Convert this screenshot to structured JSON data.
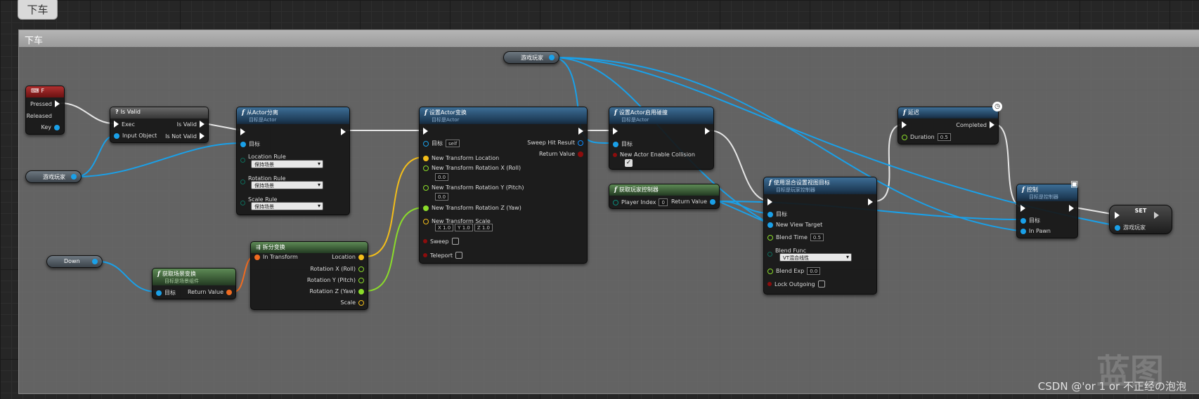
{
  "comment": {
    "tab_label": "下车",
    "header_label": "下车"
  },
  "colors": {
    "exec": "#ffffff",
    "object": "#1aa0e8",
    "bool": "#8c0d0d",
    "float": "#8bdc2a",
    "vector": "#f3be1a",
    "rotator": "#9bb0ff",
    "transform": "#f06b20",
    "byte": "#0e6b5a",
    "struct": "#0a8a7a"
  },
  "nodes": {
    "input_f": {
      "title": "F",
      "icon": "keyboard-icon",
      "pins": [
        "Pressed",
        "Released",
        "Key"
      ]
    },
    "is_valid": {
      "title": "Is Valid",
      "icon": "question-icon",
      "in_exec": "Exec",
      "in_obj": "Input Object",
      "out_valid": "Is Valid",
      "out_not": "Is Not Valid"
    },
    "detach": {
      "title": "从Actor分离",
      "subtitle": "目标是Actor",
      "target": "目标",
      "loc_rule": "Location Rule",
      "rot_rule": "Rotation Rule",
      "scale_rule": "Scale Rule",
      "rule_value": "保持场景"
    },
    "set_transform": {
      "title": "设置Actor变换",
      "subtitle": "目标是Actor",
      "target": "目标",
      "self": "self",
      "sweep_hit": "Sweep Hit Result",
      "ret": "Return Value",
      "loc": "New Transform Location",
      "rx": "New Transform Rotation X (Roll)",
      "ry": "New Transform Rotation Y (Pitch)",
      "rz": "New Transform Rotation Z (Yaw)",
      "scale": "New Transform Scale",
      "zero": "0.0",
      "sx": "X",
      "sy": "Y",
      "sz": "Z",
      "one": "1.0",
      "sweep": "Sweep",
      "teleport": "Teleport"
    },
    "set_collision": {
      "title": "设置Actor启用碰撞",
      "subtitle": "目标是Actor",
      "target": "目标",
      "enable": "New Actor Enable Collision"
    },
    "get_pc": {
      "title": "获取玩家控制器",
      "player_index": "Player Index",
      "index_value": "0",
      "ret": "Return Value"
    },
    "set_view": {
      "title": "使用混合设置视图目标",
      "subtitle": "目标是玩家控制器",
      "target": "目标",
      "new_view": "New View Target",
      "blend_time": "Blend Time",
      "blend_time_value": "0.5",
      "blend_func": "Blend Func",
      "blend_func_value": "VT混合线性",
      "blend_exp": "Blend Exp",
      "blend_exp_value": "0.0",
      "lock": "Lock Outgoing"
    },
    "delay": {
      "title": "延迟",
      "completed": "Completed",
      "duration": "Duration",
      "duration_value": "0.5"
    },
    "possess": {
      "title": "控制",
      "subtitle": "目标是控制器",
      "target": "目标",
      "in_pawn": "In Pawn"
    },
    "set_var": {
      "title": "SET",
      "var": "游戏玩家"
    },
    "get_world": {
      "title": "获取场景变换",
      "subtitle": "目标是场景组件",
      "target": "目标",
      "ret": "Return Value"
    },
    "break": {
      "title": "拆分变换",
      "in": "In Transform",
      "loc": "Location",
      "rx": "Rotation X (Roll)",
      "ry": "Rotation Y (Pitch)",
      "rz": "Rotation Z (Yaw)",
      "scale": "Scale"
    }
  },
  "vars": {
    "player_left": "游戏玩家",
    "player_top": "游戏玩家",
    "down": "Down"
  },
  "watermark": "CSDN @'or 1 or 不正经の泡泡",
  "watermark_logo": "蓝图"
}
